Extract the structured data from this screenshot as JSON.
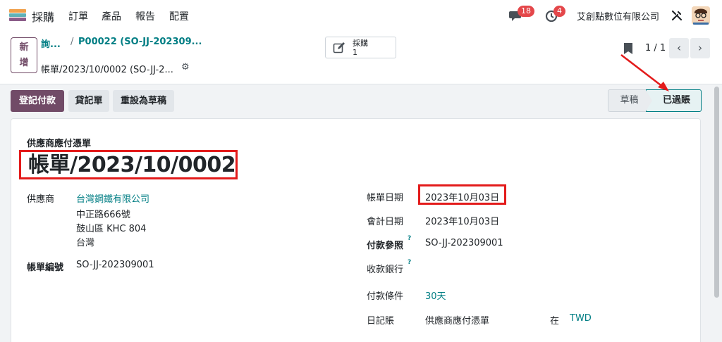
{
  "nav": {
    "brand": "採購",
    "menu": [
      "訂單",
      "產品",
      "報告",
      "配置"
    ],
    "messages_count": "18",
    "activities_count": "4",
    "company": "艾創點數位有限公司"
  },
  "control": {
    "new_label_1": "新",
    "new_label_2": "增",
    "breadcrumb_1": "詢...",
    "breadcrumb_sep": "/",
    "breadcrumb_2": "P00022 (SO-JJ-202309...",
    "record_title": "帳單/2023/10/0002 (SO-JJ-2...",
    "smart_button_label": "採購",
    "smart_button_count": "1",
    "pager": "1 / 1"
  },
  "actions": {
    "register_payment": "登記付款",
    "credit_note": "貸記單",
    "reset_to_draft": "重設為草稿"
  },
  "status": {
    "stages": [
      "草稿",
      "已過賬"
    ],
    "current": "已過賬"
  },
  "form": {
    "subtitle": "供應商應付憑單",
    "name": "帳單/2023/10/0002",
    "vendor_label": "供應商",
    "vendor_name": "台灣鋼鐵有限公司",
    "vendor_address": [
      "中正路666號",
      "鼓山區 KHC 804",
      "台灣"
    ],
    "bill_ref_label": "帳單編號",
    "bill_ref": "SO-JJ-202309001",
    "bill_date_label": "帳單日期",
    "bill_date": "2023年10月03日",
    "accounting_date_label": "會計日期",
    "accounting_date": "2023年10月03日",
    "payment_ref_label": "付款參照",
    "payment_ref": "SO-JJ-202309001",
    "bank_label": "收款銀行",
    "terms_label": "付款條件",
    "terms": "30天",
    "journal_label": "日記賬",
    "journal": "供應商應付憑單",
    "in_label": "在",
    "currency": "TWD",
    "help_mark": "?"
  },
  "colors": {
    "primary": "#714b67",
    "link": "#017e84",
    "badge": "#e4474a",
    "highlight": "#e31b1b"
  }
}
